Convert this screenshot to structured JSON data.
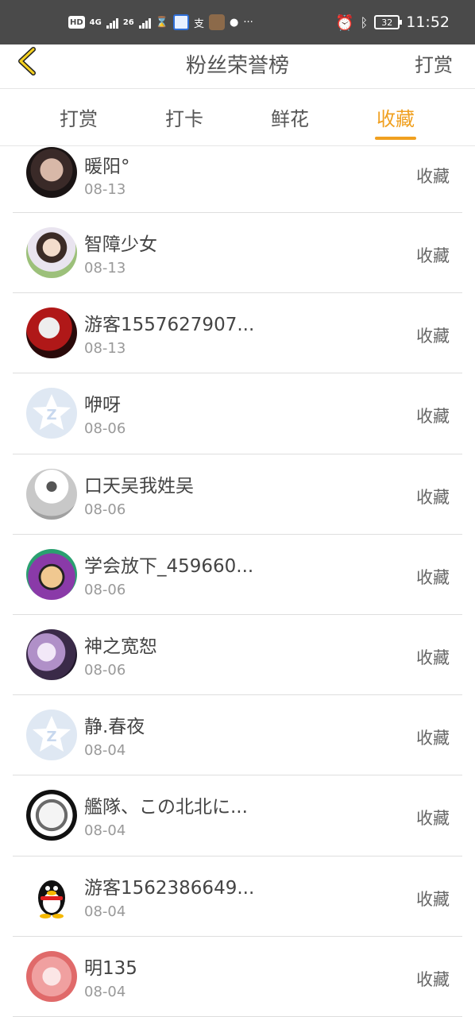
{
  "status_bar": {
    "hd": "HD",
    "net1": "4G",
    "net2": "26",
    "more": "···",
    "battery": "32",
    "time": "11:52"
  },
  "navbar": {
    "title": "粉丝荣誉榜",
    "action": "打赏"
  },
  "tabs": [
    {
      "label": "打赏",
      "active": false
    },
    {
      "label": "打卡",
      "active": false
    },
    {
      "label": "鲜花",
      "active": false
    },
    {
      "label": "收藏",
      "active": true
    }
  ],
  "accent_color": "#f0a020",
  "fans": [
    {
      "name": "暖阳°",
      "date": "08-13",
      "action": "收藏",
      "avatar": "avatar-photo-1"
    },
    {
      "name": "智障少女",
      "date": "08-13",
      "action": "收藏",
      "avatar": "avatar-photo-2"
    },
    {
      "name": "游客1557627907...",
      "date": "08-13",
      "action": "收藏",
      "avatar": "avatar-photo-3"
    },
    {
      "name": "咿呀",
      "date": "08-06",
      "action": "收藏",
      "avatar": "default-qzone-icon"
    },
    {
      "name": "口天吴我姓吴",
      "date": "08-06",
      "action": "收藏",
      "avatar": "avatar-photo-4"
    },
    {
      "name": "学会放下_459660...",
      "date": "08-06",
      "action": "收藏",
      "avatar": "avatar-cartoon-1"
    },
    {
      "name": "神之宽恕",
      "date": "08-06",
      "action": "收藏",
      "avatar": "avatar-photo-5"
    },
    {
      "name": "静.春夜",
      "date": "08-04",
      "action": "收藏",
      "avatar": "default-qzone-icon"
    },
    {
      "name": "艦隊、この北北に...",
      "date": "08-04",
      "action": "收藏",
      "avatar": "avatar-anime-1"
    },
    {
      "name": "游客1562386649...",
      "date": "08-04",
      "action": "收藏",
      "avatar": "qq-penguin-icon"
    },
    {
      "name": "明135",
      "date": "08-04",
      "action": "收藏",
      "avatar": "avatar-photo-6"
    }
  ]
}
